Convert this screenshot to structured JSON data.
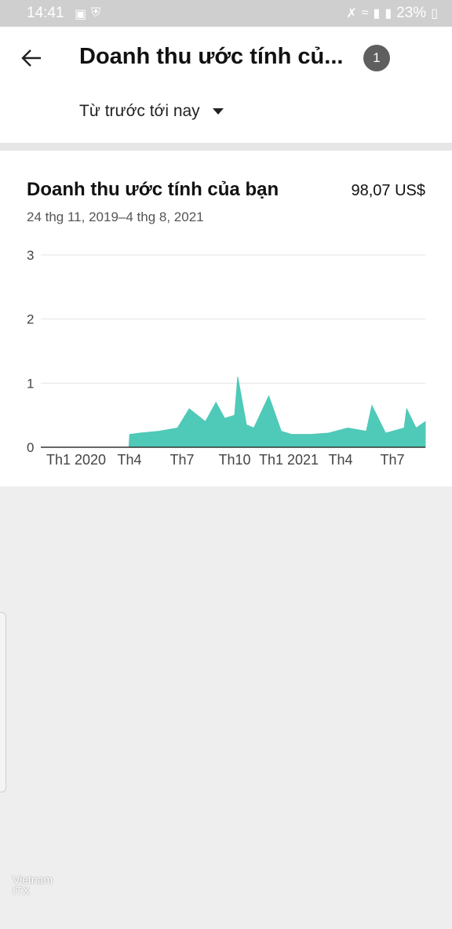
{
  "status_bar": {
    "time": "14:41",
    "battery": "23%",
    "left_icons": [
      "image-icon",
      "shield-icon"
    ],
    "right_icons": [
      "mute-icon",
      "wifi-icon",
      "signal-icon",
      "signal-icon",
      "battery-icon"
    ]
  },
  "header": {
    "title": "Doanh thu ước tính củ...",
    "badge": "1",
    "range_label": "Từ trước tới nay"
  },
  "card": {
    "title": "Doanh thu ước tính của bạn",
    "total": "98,07 US$",
    "date_range": "24 thg 11, 2019–4 thg 8, 2021"
  },
  "watermark": {
    "line1": "Vietnam",
    "line2": "ITX"
  },
  "colors": {
    "series": "#4fc9b8",
    "axis": "#333333",
    "grid": "#e4e4e4"
  },
  "chart_data": {
    "type": "area",
    "title": "",
    "xlabel": "",
    "ylabel": "",
    "ylim": [
      0,
      3
    ],
    "yticks": [
      "0",
      "1",
      "2",
      "3"
    ],
    "xticks": [
      "Th1 2020",
      "Th4",
      "Th7",
      "Th10",
      "Th1 2021",
      "Th4",
      "Th7"
    ],
    "x_start": "2019-11-24",
    "x_end": "2021-08-04",
    "grid": true,
    "legend": "none",
    "series": [
      {
        "x": [
          "2019-11-24",
          "2020-01-01",
          "2020-03-01",
          "2020-04-14",
          "2020-04-15",
          "2020-05-01",
          "2020-06-01",
          "2020-07-01",
          "2020-07-20",
          "2020-08-15",
          "2020-09-01",
          "2020-09-15",
          "2020-10-01",
          "2020-10-06",
          "2020-10-20",
          "2020-11-01",
          "2020-11-25",
          "2020-12-15",
          "2021-01-01",
          "2021-02-01",
          "2021-03-01",
          "2021-04-01",
          "2021-05-01",
          "2021-05-10",
          "2021-06-01",
          "2021-07-01",
          "2021-07-05",
          "2021-07-20",
          "2021-08-04"
        ],
        "values": [
          0,
          0,
          0,
          0,
          0.2,
          0.22,
          0.25,
          0.3,
          0.6,
          0.4,
          0.7,
          0.45,
          0.5,
          1.1,
          0.35,
          0.3,
          0.8,
          0.25,
          0.2,
          0.2,
          0.22,
          0.3,
          0.25,
          0.65,
          0.22,
          0.3,
          0.6,
          0.3,
          0.4
        ]
      }
    ]
  }
}
